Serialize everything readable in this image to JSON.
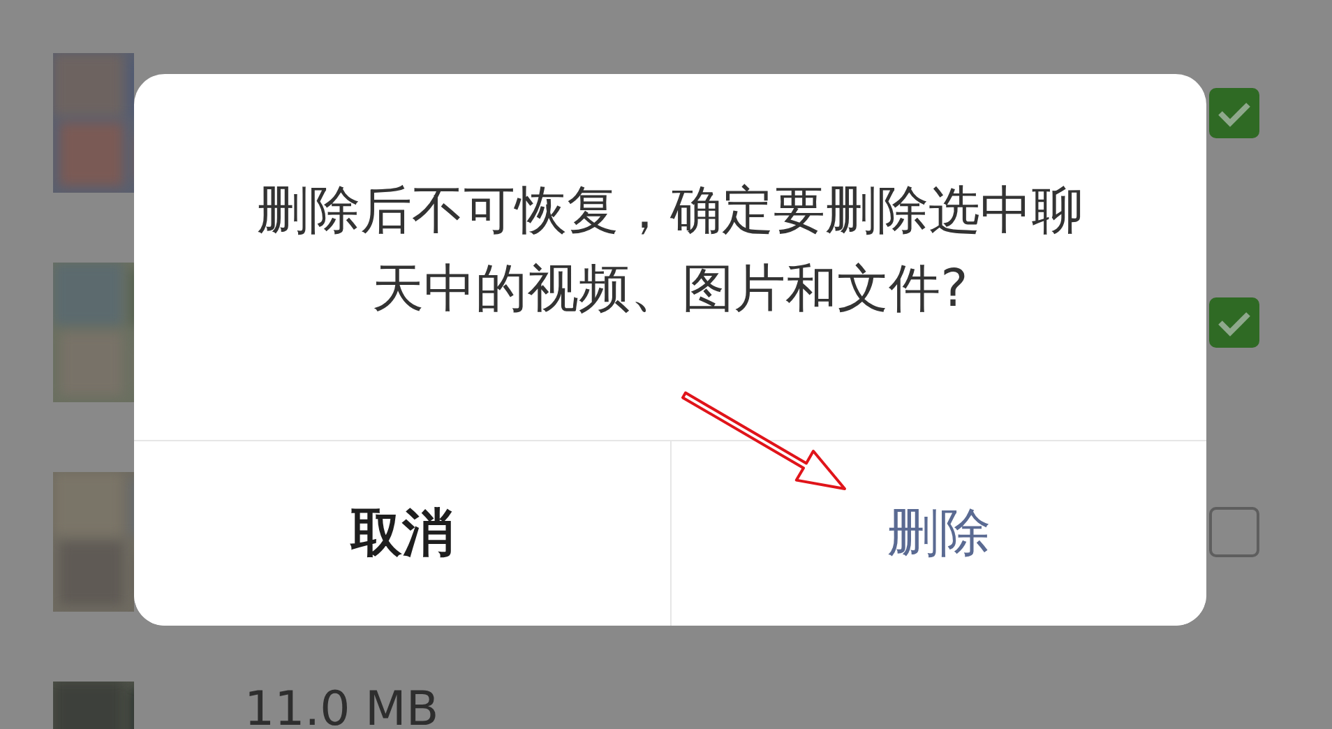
{
  "file_rows": [
    {
      "checked": true
    },
    {
      "checked": true
    },
    {
      "checked": false
    },
    {
      "size": "11.0 MB"
    }
  ],
  "dialog": {
    "message": "删除后不可恢复，确定要删除选中聊天中的视频、图片和文件?",
    "buttons": [
      {
        "label": "取消",
        "kind": "cancel"
      },
      {
        "label": "删除",
        "kind": "destructive"
      }
    ]
  }
}
